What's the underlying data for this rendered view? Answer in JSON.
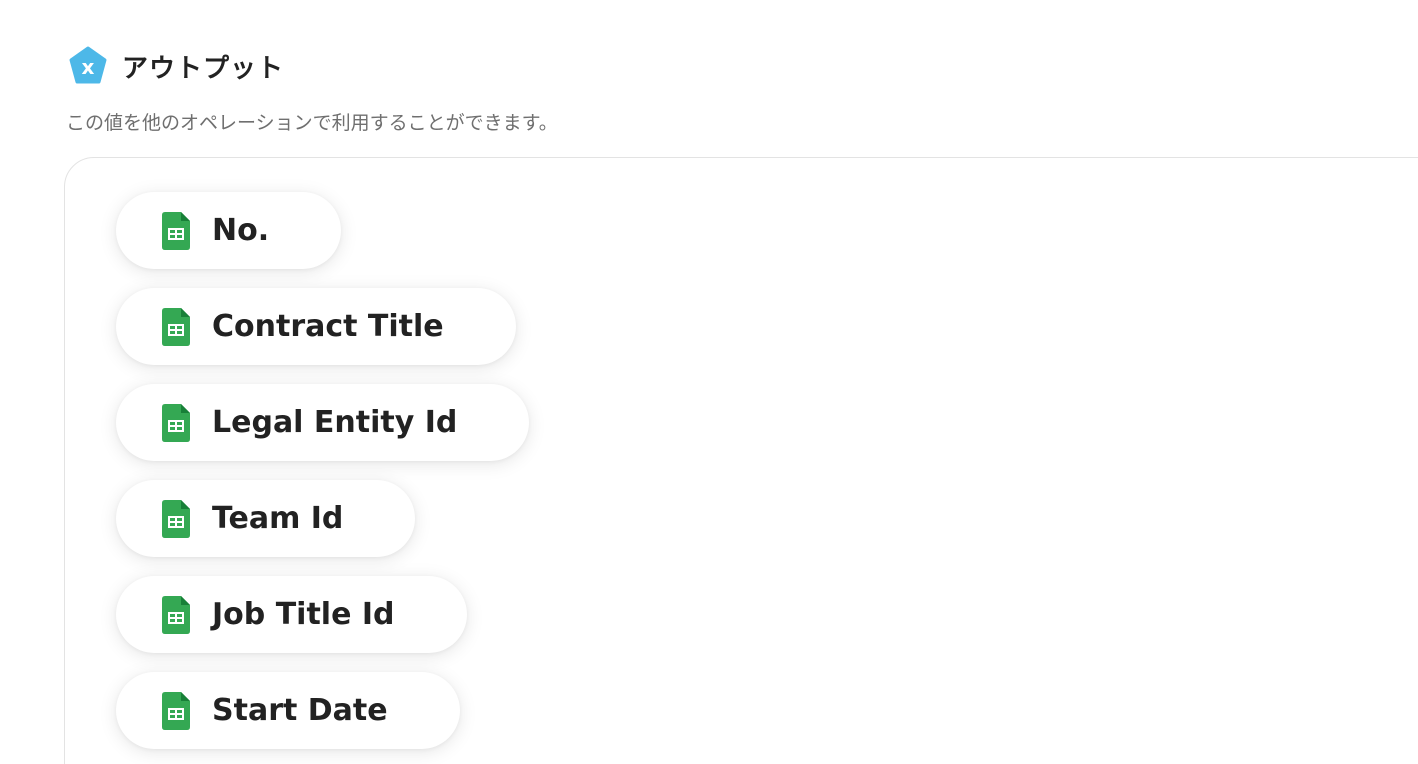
{
  "output_section": {
    "icon": "x-pentagon-icon",
    "title": "アウトプット",
    "description": "この値を他のオペレーションで利用することができます。",
    "accent_color": "#4db8e8"
  },
  "output_items": {
    "icon": "google-sheets-icon",
    "icon_color": "#34a853",
    "items": [
      {
        "label": "No."
      },
      {
        "label": "Contract Title"
      },
      {
        "label": "Legal Entity Id"
      },
      {
        "label": "Team Id"
      },
      {
        "label": "Job Title Id"
      },
      {
        "label": "Start Date"
      }
    ]
  }
}
